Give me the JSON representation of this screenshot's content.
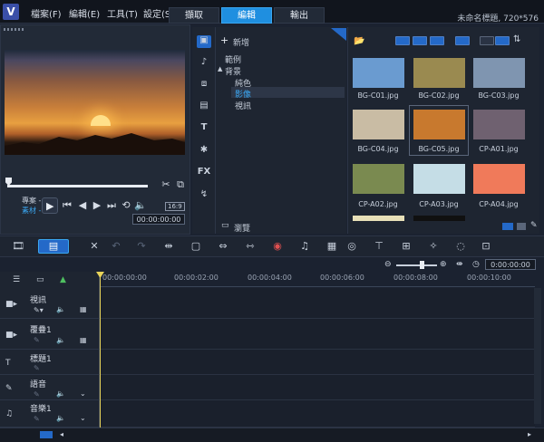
{
  "app": {
    "logo": "V",
    "project_title": "未命名標題, 720*576"
  },
  "menu": [
    {
      "label": "檔案(F)"
    },
    {
      "label": "編輯(E)"
    },
    {
      "label": "工具(T)"
    },
    {
      "label": "設定(S)"
    }
  ],
  "modes": [
    {
      "label": "擷取"
    },
    {
      "label": "編輯"
    },
    {
      "label": "輸出"
    }
  ],
  "preview": {
    "mode_project": "專案 -",
    "mode_clip": "素材 -",
    "ratio": "16:9",
    "timecode": "00:00:00:00"
  },
  "library": {
    "add_label": "新增",
    "tree": [
      {
        "label": "範例"
      },
      {
        "label": "背景"
      },
      {
        "label": "純色"
      },
      {
        "label": "影像"
      },
      {
        "label": "視訊"
      }
    ],
    "browse_label": "瀏覽",
    "thumbs": [
      {
        "name": "BG-C01.jpg",
        "color": "#6a9bd0"
      },
      {
        "name": "BG-C02.jpg",
        "color": "#9a8a50"
      },
      {
        "name": "BG-C03.jpg",
        "color": "#7f95b0"
      },
      {
        "name": "BG-C04.jpg",
        "color": "#c9bca4"
      },
      {
        "name": "BG-C05.jpg",
        "color": "#c8792e"
      },
      {
        "name": "CP-A01.jpg",
        "color": "#6f6170"
      },
      {
        "name": "CP-A02.jpg",
        "color": "#7a8a50"
      },
      {
        "name": "CP-A03.jpg",
        "color": "#c5dde6"
      },
      {
        "name": "CP-A04.jpg",
        "color": "#f07a5a"
      }
    ]
  },
  "timeline": {
    "zoom_time": "0:00:00:00",
    "ruler": [
      "00:00:00:00",
      "00:00:02:00",
      "00:00:04:00",
      "00:00:06:00",
      "00:00:08:00",
      "00:00:10:00"
    ],
    "tracks": [
      {
        "name": "視訊"
      },
      {
        "name": "覆疊1"
      },
      {
        "name": "標題1"
      },
      {
        "name": "語音"
      },
      {
        "name": "音樂1"
      }
    ]
  }
}
